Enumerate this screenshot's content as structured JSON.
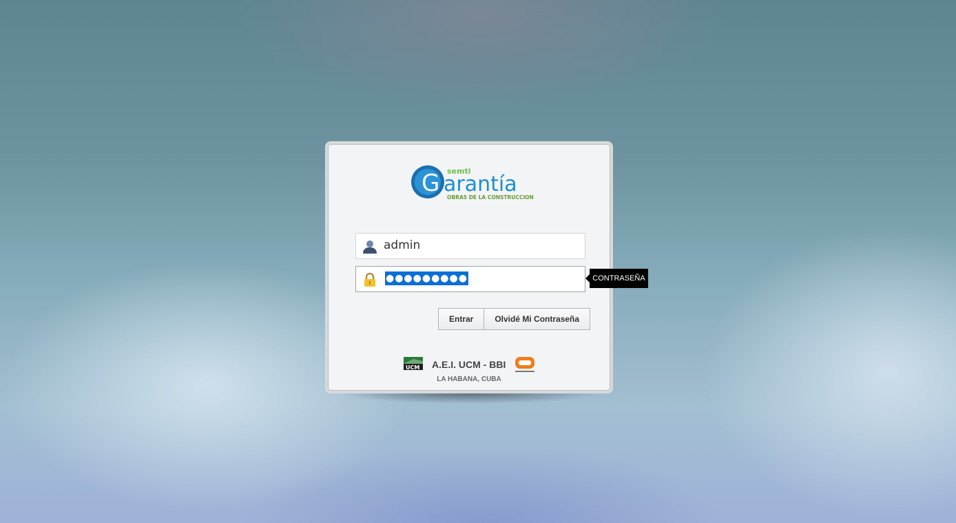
{
  "logo": {
    "brand_small": "semti",
    "brand_main": "arantía",
    "brand_initial": "G",
    "tagline": "OBRAS DE LA CONSTRUCCION"
  },
  "login": {
    "username_value": "admin",
    "password_masked": "●●●●●●●●●",
    "password_tooltip": "CONTRASEÑA"
  },
  "buttons": {
    "submit_label": "Entrar",
    "forgot_label": "Olvidé Mi Contraseña"
  },
  "footer": {
    "ucm_label": "UCM",
    "company": "A.E.I. UCM - BBI",
    "location": "LA HABANA, CUBA"
  },
  "icons": {
    "user": "user-icon",
    "lock": "lock-icon"
  },
  "colors": {
    "brand_blue": "#1b8fd0",
    "brand_green": "#6cc04a",
    "selection": "#0b6fd6",
    "lock": "#f2c12e",
    "bbi_orange": "#f07d1a"
  }
}
